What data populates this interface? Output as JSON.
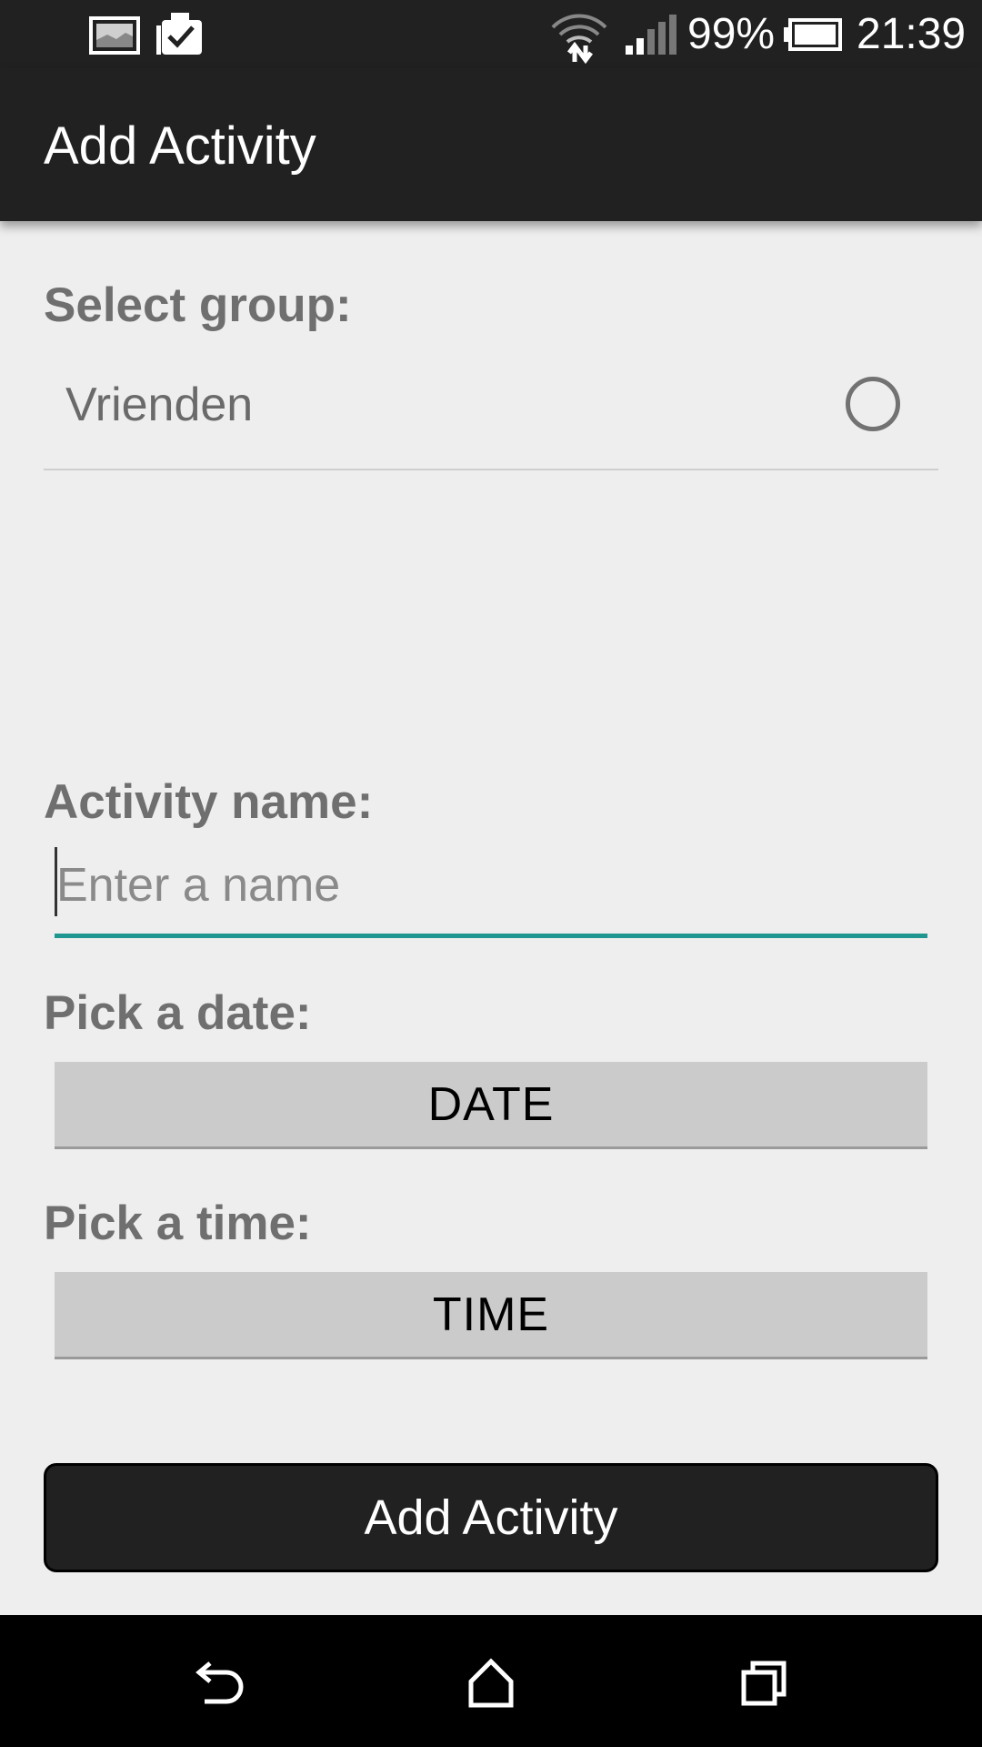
{
  "status_bar": {
    "battery": "99%",
    "time": "21:39",
    "icons": [
      "image-icon",
      "clipboard-check-icon",
      "wifi-icon",
      "signal-icon",
      "battery-icon"
    ]
  },
  "app_bar": {
    "title": "Add Activity"
  },
  "form": {
    "group_label": "Select group:",
    "group_value": "Vrienden",
    "name_label": "Activity name:",
    "name_placeholder": "Enter a name",
    "name_value": "",
    "date_label": "Pick a date:",
    "date_button": "DATE",
    "time_label": "Pick a time:",
    "time_button": "TIME",
    "submit_button": "Add Activity"
  },
  "nav_bar": {
    "icons": [
      "back-icon",
      "home-icon",
      "recents-icon"
    ]
  },
  "colors": {
    "bar": "#212121",
    "background": "#eeeeee",
    "accent": "#1f9690",
    "label": "#6f6f6f",
    "button": "#cbcbcb"
  }
}
